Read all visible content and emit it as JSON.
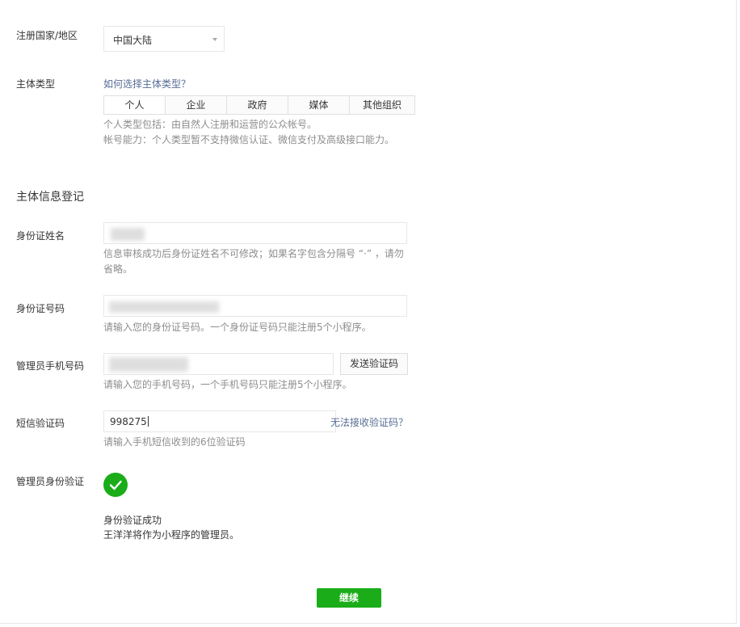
{
  "region": {
    "label": "注册国家/地区",
    "selected": "中国大陆"
  },
  "subject_type": {
    "label": "主体类型",
    "help_link": "如何选择主体类型？",
    "options": [
      "个人",
      "企业",
      "政府",
      "媒体",
      "其他组织"
    ],
    "selected": "个人",
    "tip_line1": "个人类型包括：由自然人注册和运营的公众帐号。",
    "tip_line2": "帐号能力：个人类型暂不支持微信认证、微信支付及高级接口能力。"
  },
  "section_title": "主体信息登记",
  "id_name": {
    "label": "身份证姓名",
    "tip_line1": "信息审核成功后身份证姓名不可修改；如果名字包含分隔号 “·” ，请勿",
    "tip_line2": "省略。"
  },
  "id_number": {
    "label": "身份证号码",
    "tip": "请输入您的身份证号码。一个身份证号码只能注册5个小程序。"
  },
  "admin_phone": {
    "label": "管理员手机号码",
    "send_button": "发送验证码",
    "tip": "请输入您的手机号码，一个手机号码只能注册5个小程序。"
  },
  "sms_code": {
    "label": "短信验证码",
    "value": "998275",
    "help_link": "无法接收验证码？",
    "tip": "请输入手机短信收到的6位验证码"
  },
  "admin_verify": {
    "label": "管理员身份验证",
    "status": "身份验证成功",
    "message": "王洋洋将作为小程序的管理员。"
  },
  "continue_button": "继续",
  "colors": {
    "accent_green": "#1aad19",
    "link_blue": "#576b95",
    "tip_gray": "#8d8d8d"
  }
}
